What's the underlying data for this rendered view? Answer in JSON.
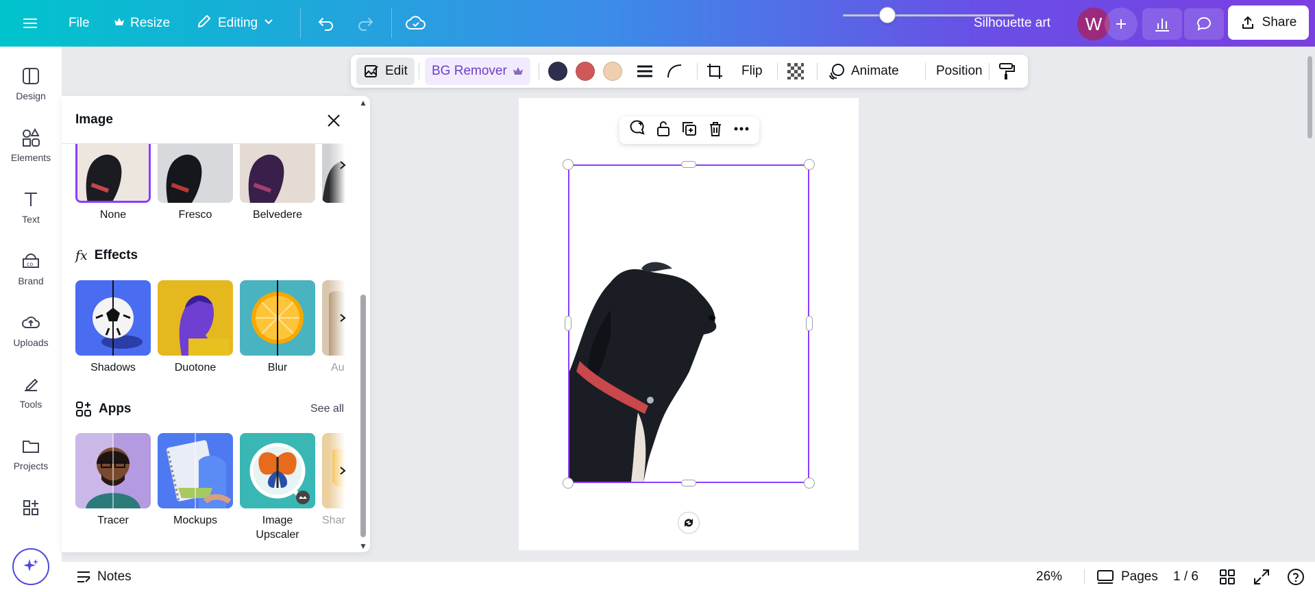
{
  "topbar": {
    "menu_icon": "hamburger-icon",
    "file": "File",
    "resize": "Resize",
    "editing": "Editing",
    "title": "Silhouette art",
    "avatar_letter": "W",
    "share": "Share"
  },
  "rail": {
    "items": [
      {
        "label": "Design",
        "icon": "design-icon"
      },
      {
        "label": "Elements",
        "icon": "elements-icon"
      },
      {
        "label": "Text",
        "icon": "text-icon"
      },
      {
        "label": "Brand",
        "icon": "brand-icon"
      },
      {
        "label": "Uploads",
        "icon": "uploads-icon"
      },
      {
        "label": "Tools",
        "icon": "tools-icon"
      },
      {
        "label": "Projects",
        "icon": "projects-icon"
      },
      {
        "label": "",
        "icon": "apps-icon"
      }
    ]
  },
  "panel": {
    "title": "Image",
    "filters": [
      "None",
      "Fresco",
      "Belvedere"
    ],
    "effects_title": "Effects",
    "effects": [
      "Shadows",
      "Duotone",
      "Blur",
      "Au"
    ],
    "apps_title": "Apps",
    "see_all": "See all",
    "apps": [
      "Tracer",
      "Mockups",
      "Image Upscaler",
      "Shar"
    ]
  },
  "context_toolbar": {
    "edit": "Edit",
    "bg_remover": "BG Remover",
    "colors": [
      "#2e2f4f",
      "#d0585a",
      "#efcfb0"
    ],
    "flip": "Flip",
    "animate": "Animate",
    "position": "Position"
  },
  "bottombar": {
    "notes": "Notes",
    "zoom": "26%",
    "zoom_level": 0.26,
    "pages": "Pages",
    "page_count": "1 / 6"
  }
}
